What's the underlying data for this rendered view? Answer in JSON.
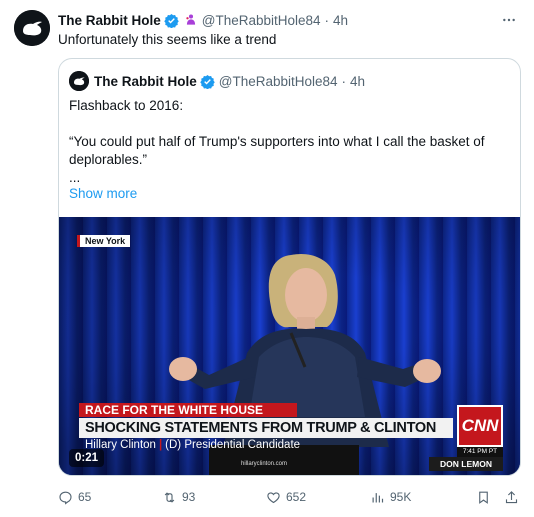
{
  "tweet": {
    "author_name": "The Rabbit Hole",
    "handle": "@TheRabbitHole84",
    "separator": "·",
    "time": "4h",
    "text": "Unfortunately this seems like a trend"
  },
  "quoted_tweet": {
    "author_name": "The Rabbit Hole",
    "handle": "@TheRabbitHole84",
    "separator": "·",
    "time": "4h",
    "line1": "Flashback to 2016:",
    "line2": "“You could put half of Trump's supporters into what I call the basket of deplorables.”",
    "line3": "...",
    "show_more": "Show more"
  },
  "video": {
    "location_tag": "New York",
    "banner_top": "RACE FOR THE WHITE HOUSE",
    "banner_main": "SHOCKING STATEMENTS FROM TRUMP & CLINTON",
    "speaker": "Hillary Clinton",
    "speaker_role": "(D) Presidential Candidate",
    "network_logo": "CNN",
    "network_time": "7:41 PM PT",
    "anchor_name": "DON LEMON",
    "podium_url": "hillaryclinton.com",
    "duration": "0:21"
  },
  "actions": {
    "replies": "65",
    "reposts": "93",
    "likes": "652",
    "views": "95K"
  },
  "colors": {
    "accent": "#1d9bf0",
    "text_secondary": "#536471",
    "cnn_red": "#c4171d"
  },
  "icons": {
    "more": "more-horizontal-icon",
    "verified": "verified-badge-icon",
    "affiliation": "affiliate-badge-icon",
    "reply": "reply-icon",
    "repost": "repost-icon",
    "like": "heart-icon",
    "views": "views-icon",
    "bookmark": "bookmark-icon",
    "share": "share-icon"
  }
}
